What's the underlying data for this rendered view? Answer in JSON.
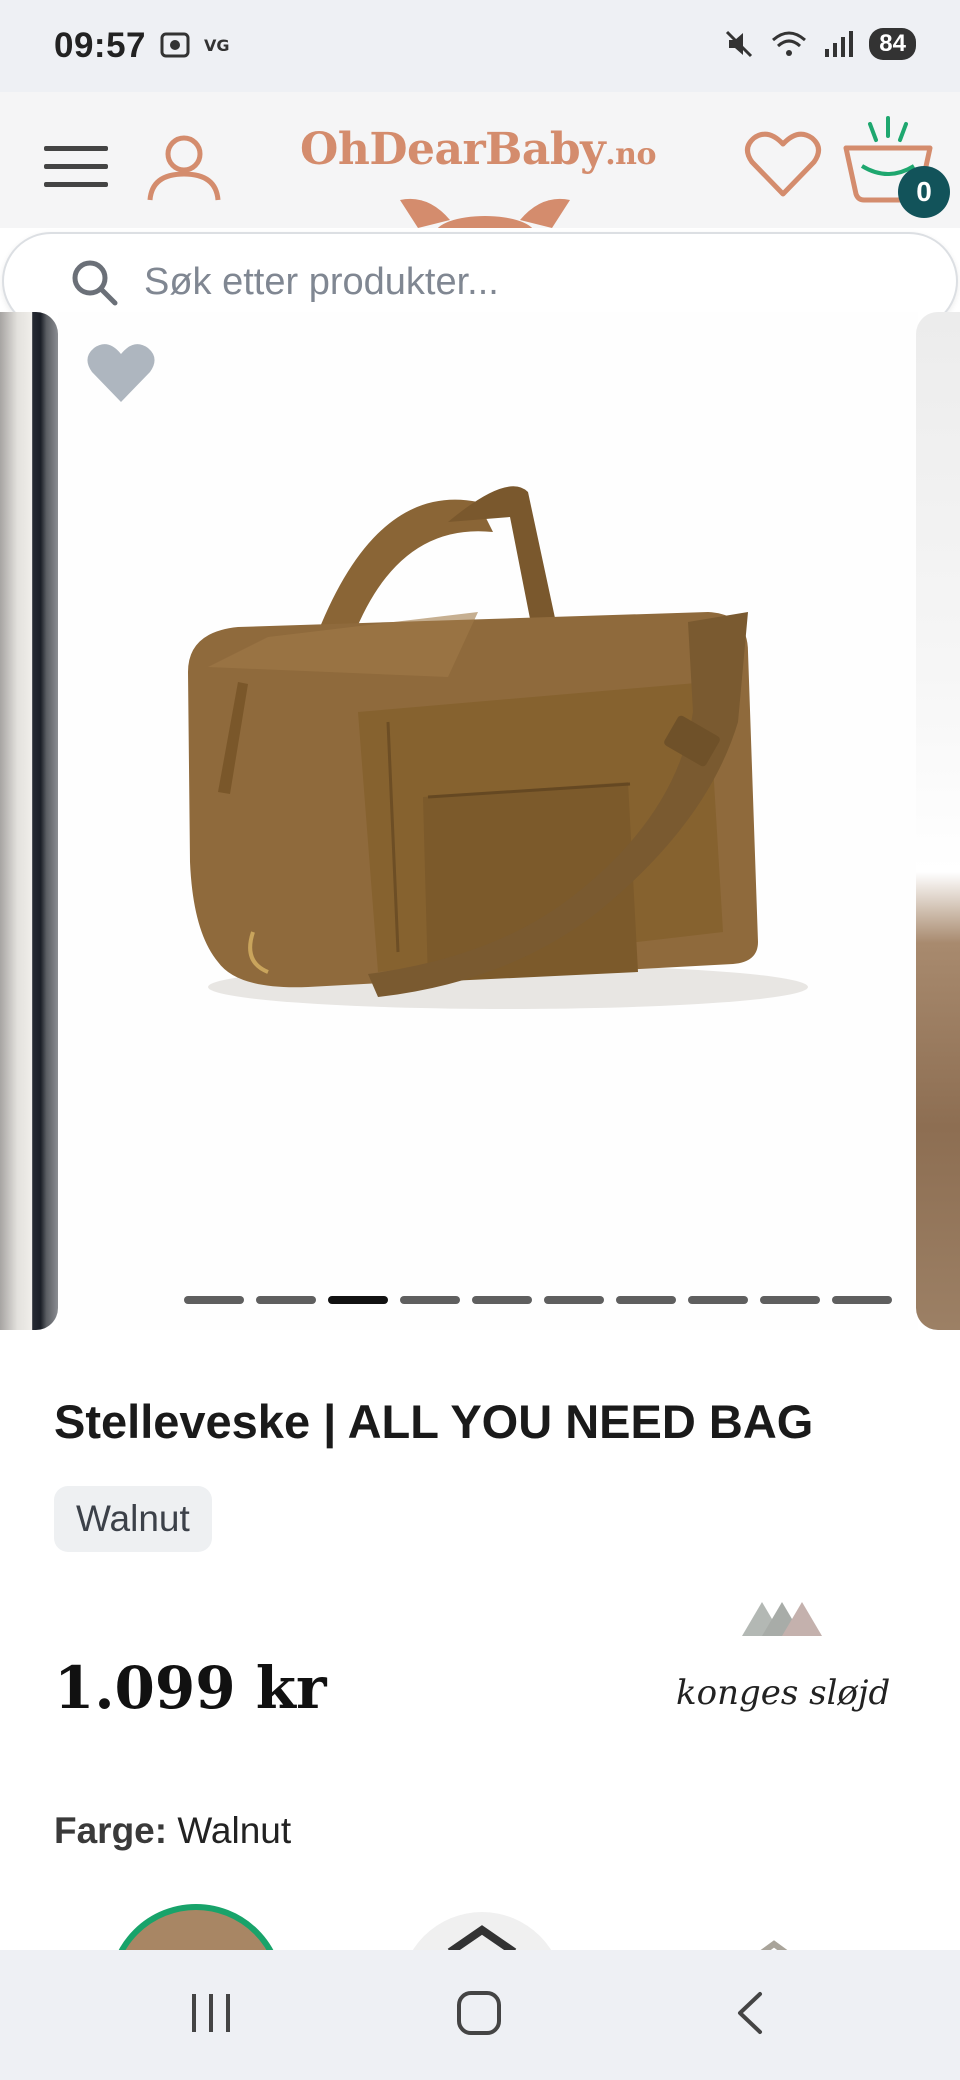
{
  "status_bar": {
    "time": "09:57",
    "battery": "84",
    "icons": [
      "screenshot-icon",
      "vg-icon",
      "mute-icon",
      "wifi-icon",
      "signal-icon"
    ]
  },
  "header": {
    "logo_main": "OhDearBaby",
    "logo_suffix": ".no",
    "cart_count": "0",
    "accent_color": "#d48c6d",
    "badge_color": "#12535a"
  },
  "search": {
    "placeholder": "Søk etter produkter..."
  },
  "carousel": {
    "slide_count": 10,
    "active_index": 2
  },
  "product": {
    "title": "Stelleveske | ALL YOU NEED BAG",
    "variant_chip": "Walnut",
    "price": "1.099 kr",
    "brand": "konges sløjd",
    "color_label": "Farge:",
    "color_value": "Walnut"
  }
}
